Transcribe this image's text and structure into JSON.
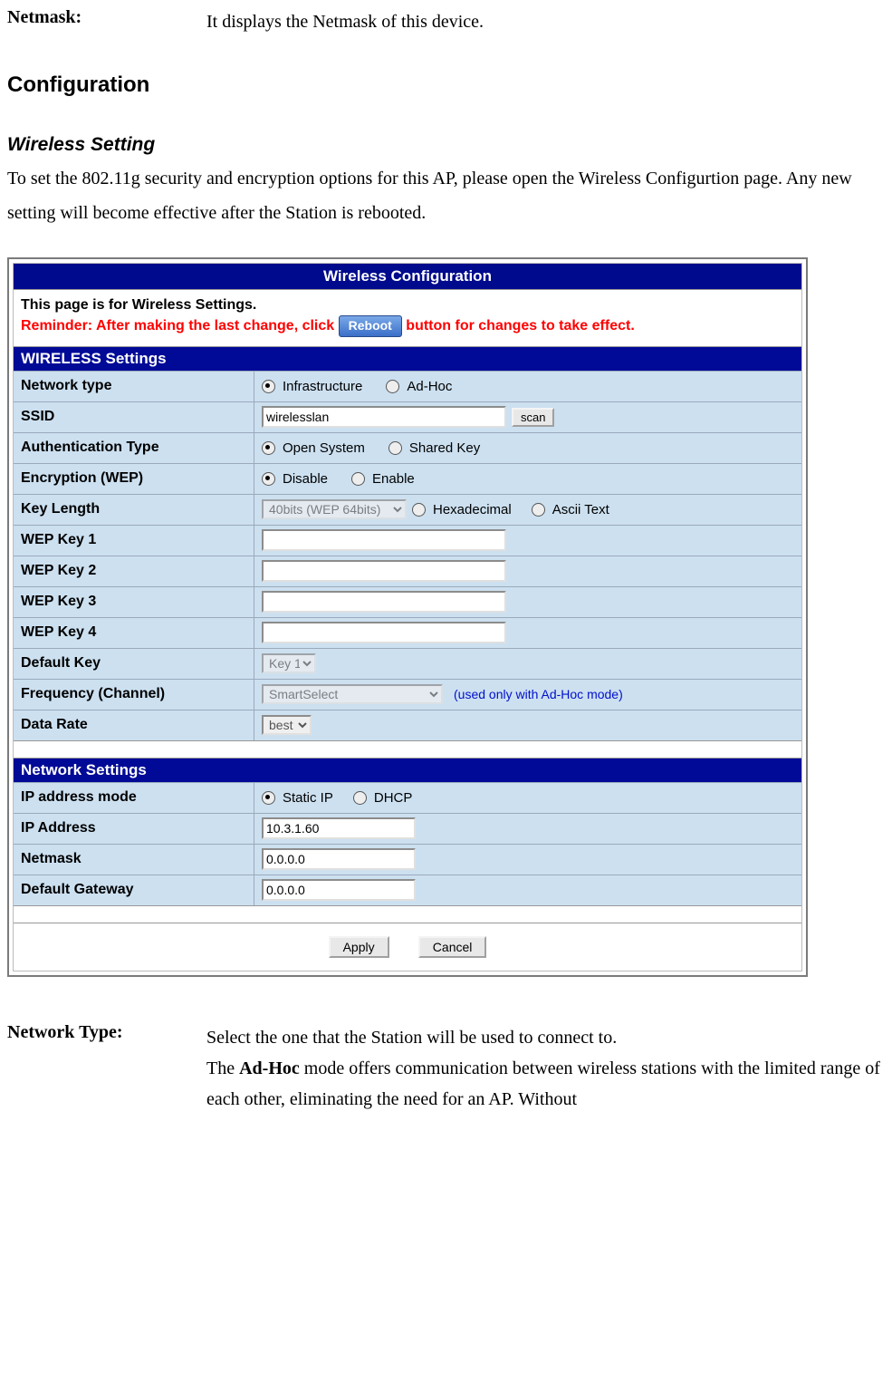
{
  "top": {
    "netmask_label": "Netmask:",
    "netmask_desc": "It displays the Netmask of this device."
  },
  "headings": {
    "configuration": "Configuration",
    "wireless_setting": "Wireless Setting"
  },
  "intro": "To set the 802.11g security and encryption options for this AP, please open the Wireless Configurtion page. Any new setting will become effective after the Station is rebooted.",
  "shot": {
    "title": "Wireless Configuration",
    "reminder_line1": "This page is for Wireless Settings.",
    "reminder_prefix": "Reminder: After making the last change, click",
    "reminder_btn": "Reboot",
    "reminder_suffix": "button for changes to take effect.",
    "wireless_section": "WIRELESS Settings",
    "rows": {
      "network_type": {
        "label": "Network type",
        "opt1": "Infrastructure",
        "opt2": "Ad-Hoc",
        "selected": "Infrastructure"
      },
      "ssid": {
        "label": "SSID",
        "value": "wirelesslan",
        "scan": "scan"
      },
      "auth": {
        "label": "Authentication Type",
        "opt1": "Open System",
        "opt2": "Shared Key",
        "selected": "Open System"
      },
      "enc": {
        "label": "Encryption (WEP)",
        "opt1": "Disable",
        "opt2": "Enable",
        "selected": "Disable"
      },
      "keylen": {
        "label": "Key Length",
        "select": "40bits (WEP 64bits)",
        "opt1": "Hexadecimal",
        "opt2": "Ascii Text"
      },
      "wep1": {
        "label": "WEP Key 1",
        "value": ""
      },
      "wep2": {
        "label": "WEP Key 2",
        "value": ""
      },
      "wep3": {
        "label": "WEP Key 3",
        "value": ""
      },
      "wep4": {
        "label": "WEP Key 4",
        "value": ""
      },
      "defkey": {
        "label": "Default Key",
        "select": "Key 1"
      },
      "freq": {
        "label": "Frequency (Channel)",
        "select": "SmartSelect",
        "note": "(used only with Ad-Hoc mode)"
      },
      "rate": {
        "label": "Data Rate",
        "select": "best"
      }
    },
    "network_section": "Network Settings",
    "net": {
      "ipmode": {
        "label": "IP address mode",
        "opt1": "Static IP",
        "opt2": "DHCP",
        "selected": "Static IP"
      },
      "ip": {
        "label": "IP Address",
        "value": "10.3.1.60"
      },
      "netmask": {
        "label": "Netmask",
        "value": "0.0.0.0"
      },
      "gw": {
        "label": "Default Gateway",
        "value": "0.0.0.0"
      }
    },
    "apply": "Apply",
    "cancel": "Cancel"
  },
  "bottom": {
    "nettype_label": "Network Type:",
    "line1": "Select the one that the Station will be used to connect to.",
    "line2a": "The ",
    "line2b": "Ad-Hoc",
    "line2c": " mode offers communication between wireless stations with the limited range of each other, eliminating the need for an AP. Without"
  }
}
